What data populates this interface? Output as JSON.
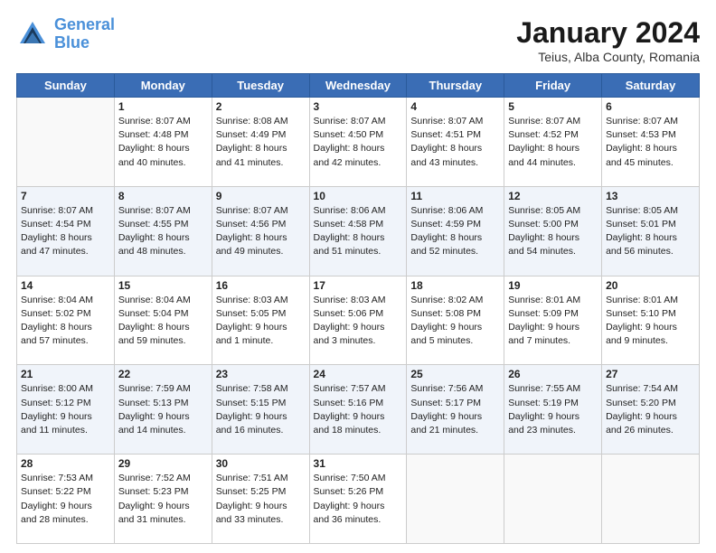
{
  "header": {
    "logo_line1": "General",
    "logo_line2": "Blue",
    "main_title": "January 2024",
    "subtitle": "Teius, Alba County, Romania"
  },
  "weekdays": [
    "Sunday",
    "Monday",
    "Tuesday",
    "Wednesday",
    "Thursday",
    "Friday",
    "Saturday"
  ],
  "weeks": [
    [
      {
        "day": "",
        "info": ""
      },
      {
        "day": "1",
        "info": "Sunrise: 8:07 AM\nSunset: 4:48 PM\nDaylight: 8 hours\nand 40 minutes."
      },
      {
        "day": "2",
        "info": "Sunrise: 8:08 AM\nSunset: 4:49 PM\nDaylight: 8 hours\nand 41 minutes."
      },
      {
        "day": "3",
        "info": "Sunrise: 8:07 AM\nSunset: 4:50 PM\nDaylight: 8 hours\nand 42 minutes."
      },
      {
        "day": "4",
        "info": "Sunrise: 8:07 AM\nSunset: 4:51 PM\nDaylight: 8 hours\nand 43 minutes."
      },
      {
        "day": "5",
        "info": "Sunrise: 8:07 AM\nSunset: 4:52 PM\nDaylight: 8 hours\nand 44 minutes."
      },
      {
        "day": "6",
        "info": "Sunrise: 8:07 AM\nSunset: 4:53 PM\nDaylight: 8 hours\nand 45 minutes."
      }
    ],
    [
      {
        "day": "7",
        "info": "Sunrise: 8:07 AM\nSunset: 4:54 PM\nDaylight: 8 hours\nand 47 minutes."
      },
      {
        "day": "8",
        "info": "Sunrise: 8:07 AM\nSunset: 4:55 PM\nDaylight: 8 hours\nand 48 minutes."
      },
      {
        "day": "9",
        "info": "Sunrise: 8:07 AM\nSunset: 4:56 PM\nDaylight: 8 hours\nand 49 minutes."
      },
      {
        "day": "10",
        "info": "Sunrise: 8:06 AM\nSunset: 4:58 PM\nDaylight: 8 hours\nand 51 minutes."
      },
      {
        "day": "11",
        "info": "Sunrise: 8:06 AM\nSunset: 4:59 PM\nDaylight: 8 hours\nand 52 minutes."
      },
      {
        "day": "12",
        "info": "Sunrise: 8:05 AM\nSunset: 5:00 PM\nDaylight: 8 hours\nand 54 minutes."
      },
      {
        "day": "13",
        "info": "Sunrise: 8:05 AM\nSunset: 5:01 PM\nDaylight: 8 hours\nand 56 minutes."
      }
    ],
    [
      {
        "day": "14",
        "info": "Sunrise: 8:04 AM\nSunset: 5:02 PM\nDaylight: 8 hours\nand 57 minutes."
      },
      {
        "day": "15",
        "info": "Sunrise: 8:04 AM\nSunset: 5:04 PM\nDaylight: 8 hours\nand 59 minutes."
      },
      {
        "day": "16",
        "info": "Sunrise: 8:03 AM\nSunset: 5:05 PM\nDaylight: 9 hours\nand 1 minute."
      },
      {
        "day": "17",
        "info": "Sunrise: 8:03 AM\nSunset: 5:06 PM\nDaylight: 9 hours\nand 3 minutes."
      },
      {
        "day": "18",
        "info": "Sunrise: 8:02 AM\nSunset: 5:08 PM\nDaylight: 9 hours\nand 5 minutes."
      },
      {
        "day": "19",
        "info": "Sunrise: 8:01 AM\nSunset: 5:09 PM\nDaylight: 9 hours\nand 7 minutes."
      },
      {
        "day": "20",
        "info": "Sunrise: 8:01 AM\nSunset: 5:10 PM\nDaylight: 9 hours\nand 9 minutes."
      }
    ],
    [
      {
        "day": "21",
        "info": "Sunrise: 8:00 AM\nSunset: 5:12 PM\nDaylight: 9 hours\nand 11 minutes."
      },
      {
        "day": "22",
        "info": "Sunrise: 7:59 AM\nSunset: 5:13 PM\nDaylight: 9 hours\nand 14 minutes."
      },
      {
        "day": "23",
        "info": "Sunrise: 7:58 AM\nSunset: 5:15 PM\nDaylight: 9 hours\nand 16 minutes."
      },
      {
        "day": "24",
        "info": "Sunrise: 7:57 AM\nSunset: 5:16 PM\nDaylight: 9 hours\nand 18 minutes."
      },
      {
        "day": "25",
        "info": "Sunrise: 7:56 AM\nSunset: 5:17 PM\nDaylight: 9 hours\nand 21 minutes."
      },
      {
        "day": "26",
        "info": "Sunrise: 7:55 AM\nSunset: 5:19 PM\nDaylight: 9 hours\nand 23 minutes."
      },
      {
        "day": "27",
        "info": "Sunrise: 7:54 AM\nSunset: 5:20 PM\nDaylight: 9 hours\nand 26 minutes."
      }
    ],
    [
      {
        "day": "28",
        "info": "Sunrise: 7:53 AM\nSunset: 5:22 PM\nDaylight: 9 hours\nand 28 minutes."
      },
      {
        "day": "29",
        "info": "Sunrise: 7:52 AM\nSunset: 5:23 PM\nDaylight: 9 hours\nand 31 minutes."
      },
      {
        "day": "30",
        "info": "Sunrise: 7:51 AM\nSunset: 5:25 PM\nDaylight: 9 hours\nand 33 minutes."
      },
      {
        "day": "31",
        "info": "Sunrise: 7:50 AM\nSunset: 5:26 PM\nDaylight: 9 hours\nand 36 minutes."
      },
      {
        "day": "",
        "info": ""
      },
      {
        "day": "",
        "info": ""
      },
      {
        "day": "",
        "info": ""
      }
    ]
  ]
}
